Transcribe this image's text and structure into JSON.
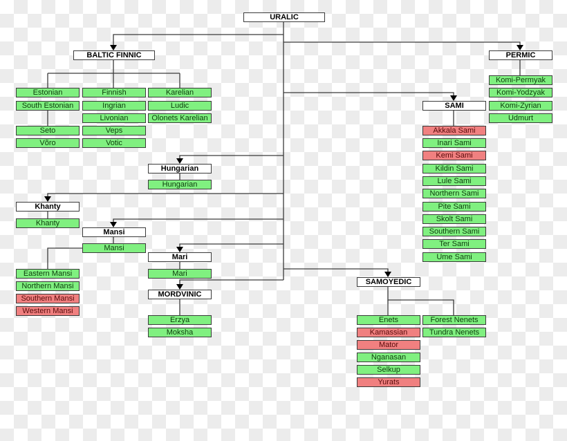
{
  "colors": {
    "living": "#80f080",
    "extinct": "#f08080",
    "group": "#ffffff",
    "line": "#3a3a3a"
  },
  "root": {
    "label": "URALIC"
  },
  "groups": {
    "baltic_finnic": {
      "label": "BALTIC FINNIC",
      "languages": [
        {
          "name": "Estonian",
          "status": "living"
        },
        {
          "name": "South Estonian",
          "status": "living"
        },
        {
          "name": "Seto",
          "status": "living"
        },
        {
          "name": "Võro",
          "status": "living"
        },
        {
          "name": "Finnish",
          "status": "living"
        },
        {
          "name": "Ingrian",
          "status": "living"
        },
        {
          "name": "Livonian",
          "status": "living"
        },
        {
          "name": "Veps",
          "status": "living"
        },
        {
          "name": "Votic",
          "status": "living"
        },
        {
          "name": "Karelian",
          "status": "living"
        },
        {
          "name": "Ludic",
          "status": "living"
        },
        {
          "name": "Olonets Karelian",
          "status": "living"
        }
      ]
    },
    "permic": {
      "label": "PERMIC",
      "languages": [
        {
          "name": "Komi-Permyak",
          "status": "living"
        },
        {
          "name": "Komi-Yodzyak",
          "status": "living"
        },
        {
          "name": "Komi-Zyrian",
          "status": "living"
        },
        {
          "name": "Udmurt",
          "status": "living"
        }
      ]
    },
    "sami": {
      "label": "SAMI",
      "languages": [
        {
          "name": "Akkala Sami",
          "status": "extinct"
        },
        {
          "name": "Inari Sami",
          "status": "living"
        },
        {
          "name": "Kemi Sami",
          "status": "extinct"
        },
        {
          "name": "Kildin Sami",
          "status": "living"
        },
        {
          "name": "Lule Sami",
          "status": "living"
        },
        {
          "name": "Northern Sami",
          "status": "living"
        },
        {
          "name": "Pite Sami",
          "status": "living"
        },
        {
          "name": "Skolt Sami",
          "status": "living"
        },
        {
          "name": "Southern Sami",
          "status": "living"
        },
        {
          "name": "Ter Sami",
          "status": "living"
        },
        {
          "name": "Ume Sami",
          "status": "living"
        }
      ]
    },
    "hungarian": {
      "label": "Hungarian",
      "languages": [
        {
          "name": "Hungarian",
          "status": "living"
        }
      ]
    },
    "khanty": {
      "label": "Khanty",
      "languages": [
        {
          "name": "Khanty",
          "status": "living"
        }
      ]
    },
    "mansi": {
      "label": "Mansi",
      "languages": [
        {
          "name": "Mansi",
          "status": "living"
        },
        {
          "name": "Eastern Mansi",
          "status": "living"
        },
        {
          "name": "Northern Mansi",
          "status": "living"
        },
        {
          "name": "Southern Mansi",
          "status": "extinct"
        },
        {
          "name": "Western Mansi",
          "status": "extinct"
        }
      ]
    },
    "mari": {
      "label": "Mari",
      "languages": [
        {
          "name": "Mari",
          "status": "living"
        }
      ]
    },
    "mordvinic": {
      "label": "MORDVINIC",
      "languages": [
        {
          "name": "Erzya",
          "status": "living"
        },
        {
          "name": "Moksha",
          "status": "living"
        }
      ]
    },
    "samoyedic": {
      "label": "SAMOYEDIC",
      "languages": [
        {
          "name": "Enets",
          "status": "living"
        },
        {
          "name": "Kamassian",
          "status": "extinct"
        },
        {
          "name": "Mator",
          "status": "extinct"
        },
        {
          "name": "Nganasan",
          "status": "living"
        },
        {
          "name": "Selkup",
          "status": "living"
        },
        {
          "name": "Yurats",
          "status": "extinct"
        },
        {
          "name": "Forest Nenets",
          "status": "living"
        },
        {
          "name": "Tundra Nenets",
          "status": "living"
        }
      ]
    }
  }
}
